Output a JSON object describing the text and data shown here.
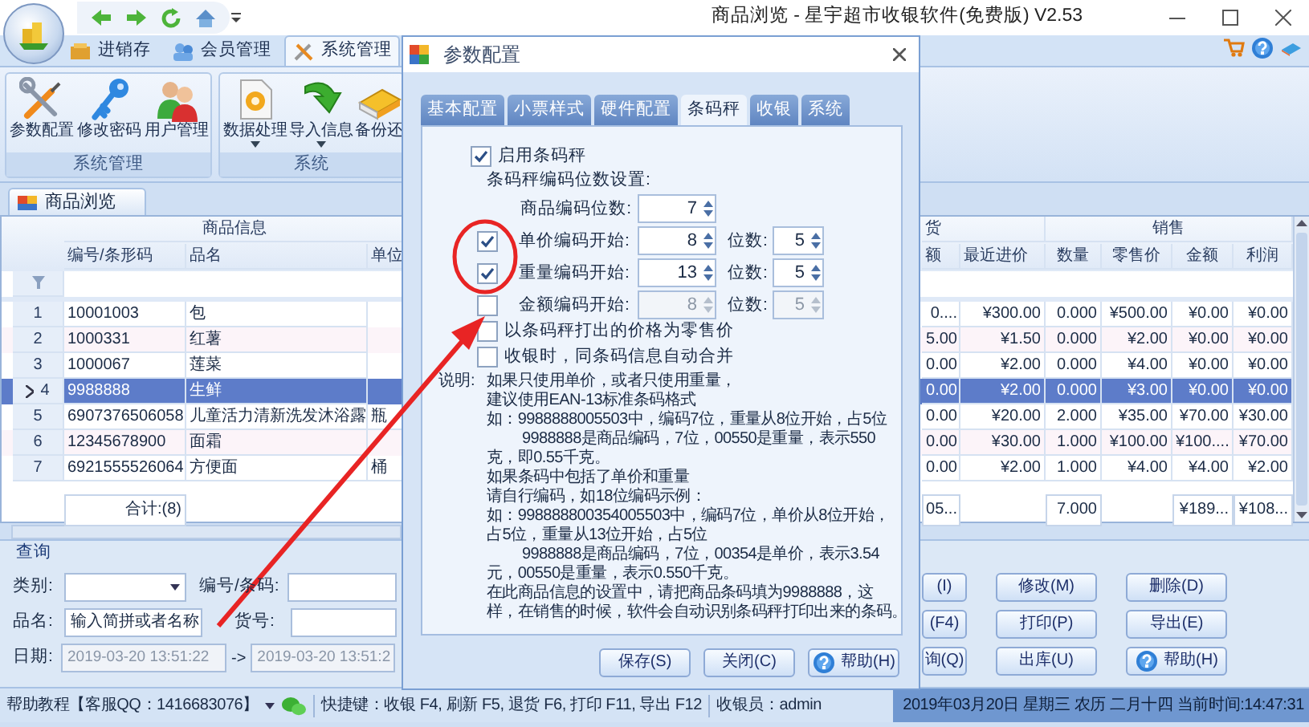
{
  "app": {
    "title": "商品浏览 - 星宇超市收银软件(免费版) V2.53"
  },
  "ribbon": {
    "tabs": [
      {
        "label": "进销存",
        "selected": false
      },
      {
        "label": "会员管理",
        "selected": false
      },
      {
        "label": "系统管理",
        "selected": true
      }
    ],
    "groups": [
      {
        "label": "系统管理",
        "buttons": [
          {
            "label": "参数配置",
            "dropdown": false
          },
          {
            "label": "修改密码",
            "dropdown": false
          },
          {
            "label": "用户管理",
            "dropdown": false
          }
        ]
      },
      {
        "label": "系统",
        "buttons": [
          {
            "label": "数据处理",
            "dropdown": true
          },
          {
            "label": "导入信息",
            "dropdown": true
          },
          {
            "label": "备份还",
            "dropdown": false
          }
        ]
      }
    ]
  },
  "document_tab": {
    "label": "商品浏览"
  },
  "grid": {
    "bands": [
      "商品信息",
      "货",
      "销售"
    ],
    "columns": [
      "编号/条形码",
      "品名",
      "单位",
      "额",
      "最近进价",
      "数量",
      "零售价",
      "金额",
      "利润"
    ],
    "rows": [
      {
        "number": "1",
        "selected": false,
        "barcode": "10001003",
        "name": "包",
        "column_4": "0....",
        "last_cost": "¥300.00",
        "quantity": "0.000",
        "retail_price": "¥500.00",
        "amount": "¥0.00",
        "profit": "¥0.00"
      },
      {
        "number": "2",
        "selected": false,
        "barcode": "1000331",
        "name": "红薯",
        "column_4": "5.00",
        "last_cost": "¥1.50",
        "quantity": "0.000",
        "retail_price": "¥2.00",
        "amount": "¥0.00",
        "profit": "¥0.00"
      },
      {
        "number": "3",
        "selected": false,
        "barcode": "1000067",
        "name": "莲菜",
        "column_4": "0.00",
        "last_cost": "¥2.00",
        "quantity": "0.000",
        "retail_price": "¥4.00",
        "amount": "¥0.00",
        "profit": "¥0.00"
      },
      {
        "number": "4",
        "selected": true,
        "barcode": "9988888",
        "name": "生鲜",
        "column_4": "0.00",
        "last_cost": "¥2.00",
        "quantity": "0.000",
        "retail_price": "¥3.00",
        "amount": "¥0.00",
        "profit": "¥0.00"
      },
      {
        "number": "5",
        "selected": false,
        "barcode": "6907376506058",
        "name": "儿童活力清新洗发沐浴露",
        "unit": "瓶",
        "column_4": "0.00",
        "last_cost": "¥20.00",
        "quantity": "2.000",
        "retail_price": "¥35.00",
        "amount": "¥70.00",
        "profit": "¥30.00"
      },
      {
        "number": "6",
        "selected": false,
        "barcode": "12345678900",
        "name": "面霜",
        "column_4": "0.00",
        "last_cost": "¥30.00",
        "quantity": "1.000",
        "retail_price": "¥100.00",
        "amount": "¥100....",
        "profit": "¥70.00"
      },
      {
        "number": "7",
        "selected": false,
        "barcode": "6921555526064",
        "name": "方便面",
        "unit": "桶",
        "column_4": "0.00",
        "last_cost": "¥2.00",
        "quantity": "1.000",
        "retail_price": "¥4.00",
        "amount": "¥4.00",
        "profit": "¥2.00"
      }
    ],
    "totals": {
      "barcode": "合计:(8)",
      "column_4": "05...",
      "quantity": "7.000",
      "amount": "¥189...",
      "profit": "¥108..."
    }
  },
  "query": {
    "title": "查询",
    "fields": [
      {
        "kind": "select",
        "label": "类别:"
      },
      {
        "kind": "text",
        "label": "编号/条码:"
      },
      {
        "kind": "text",
        "label": "品名:",
        "value": "输入简拼或者名称"
      },
      {
        "kind": "text",
        "label": "货号:"
      },
      {
        "kind": "daterange",
        "label": "日期:",
        "from": "2019-03-20 13:51:22",
        "separator": "->",
        "to": "2019-03-20 13:51:2",
        "disabled": true
      }
    ],
    "buttons": [
      {
        "label": "(I)",
        "has_icon": false
      },
      {
        "label": "修改(M)",
        "has_icon": false
      },
      {
        "label": "删除(D)",
        "has_icon": false
      },
      {
        "label": "(F4)",
        "has_icon": false
      },
      {
        "label": "打印(P)",
        "has_icon": false
      },
      {
        "label": "导出(E)",
        "has_icon": false
      },
      {
        "label": "询(Q)",
        "has_icon": false
      },
      {
        "label": "出库(U)",
        "has_icon": false
      },
      {
        "label": "帮助(H)",
        "has_icon": true
      }
    ]
  },
  "status_bar": {
    "help": "帮助教程【客服QQ：1416683076】",
    "shortcuts": "快捷键：收银 F4, 刷新 F5, 退货 F6, 打印 F11, 导出 F12",
    "cashier": "收银员：admin",
    "datetime": "2019年03月20日 星期三 农历 二月十四 当前时间:14:47:31"
  },
  "dialog": {
    "title": "参数配置",
    "tabs": [
      {
        "label": "基本配置",
        "selected": false
      },
      {
        "label": "小票样式",
        "selected": false
      },
      {
        "label": "硬件配置",
        "selected": false
      },
      {
        "label": "条码秤",
        "selected": true
      },
      {
        "label": "收银",
        "selected": false
      },
      {
        "label": "系统",
        "selected": false
      }
    ],
    "enable": {
      "label": "启用条码秤",
      "checked": true
    },
    "section_label": "条码秤编码位数设置:",
    "settings": [
      {
        "kind": "spin",
        "label": "商品编码位数:",
        "value": "7"
      },
      {
        "kind": "check-spin",
        "label": "单价编码开始:",
        "checked": true,
        "value": "8",
        "digits_label": "位数:",
        "digits": "5"
      },
      {
        "kind": "check-spin",
        "label": "重量编码开始:",
        "checked": true,
        "value": "13",
        "digits_label": "位数:",
        "digits": "5"
      },
      {
        "kind": "check-spin",
        "label": "金额编码开始:",
        "checked": false,
        "value": "8",
        "digits_label": "位数:",
        "digits": "5"
      }
    ],
    "options": [
      {
        "label": "以条码秤打出的价格为零售价",
        "checked": false
      },
      {
        "label": "收银时，同条码信息自动合并",
        "checked": false
      }
    ],
    "note_label": "说明:",
    "note_lines": [
      {
        "text": "如果只使用单价，或者只使用重量，",
        "indented": false
      },
      {
        "text": "建议使用EAN-13标准条码格式",
        "indented": false
      },
      {
        "text": "如：9988888005503中，编码7位，重量从8位开始，占5位",
        "indented": false
      },
      {
        "text": "9988888是商品编码，7位，00550是重量，表示550",
        "indented": true
      },
      {
        "text": "克，即0.55千克。",
        "indented": false
      },
      {
        "text": "如果条码中包括了单价和重量",
        "indented": false
      },
      {
        "text": "请自行编码，如18位编码示例：",
        "indented": false
      },
      {
        "text": "如：998888800354005503中，编码7位，单价从8位开始，",
        "indented": false
      },
      {
        "text": "占5位，重量从13位开始，占5位",
        "indented": false
      },
      {
        "text": "9988888是商品编码，7位，00354是单价，表示3.54",
        "indented": true
      },
      {
        "text": "元，00550是重量，表示0.550千克。",
        "indented": false
      },
      {
        "text": "在此商品信息的设置中，请把商品条码填为9988888，这",
        "indented": false
      },
      {
        "text": "样，在销售的时候，软件会自动识别条码秤打印出来的条码。",
        "indented": false
      }
    ],
    "buttons": [
      {
        "label": "保存(S)",
        "has_icon": false
      },
      {
        "label": "关闭(C)",
        "has_icon": false
      },
      {
        "label": "帮助(H)",
        "has_icon": true
      }
    ]
  }
}
